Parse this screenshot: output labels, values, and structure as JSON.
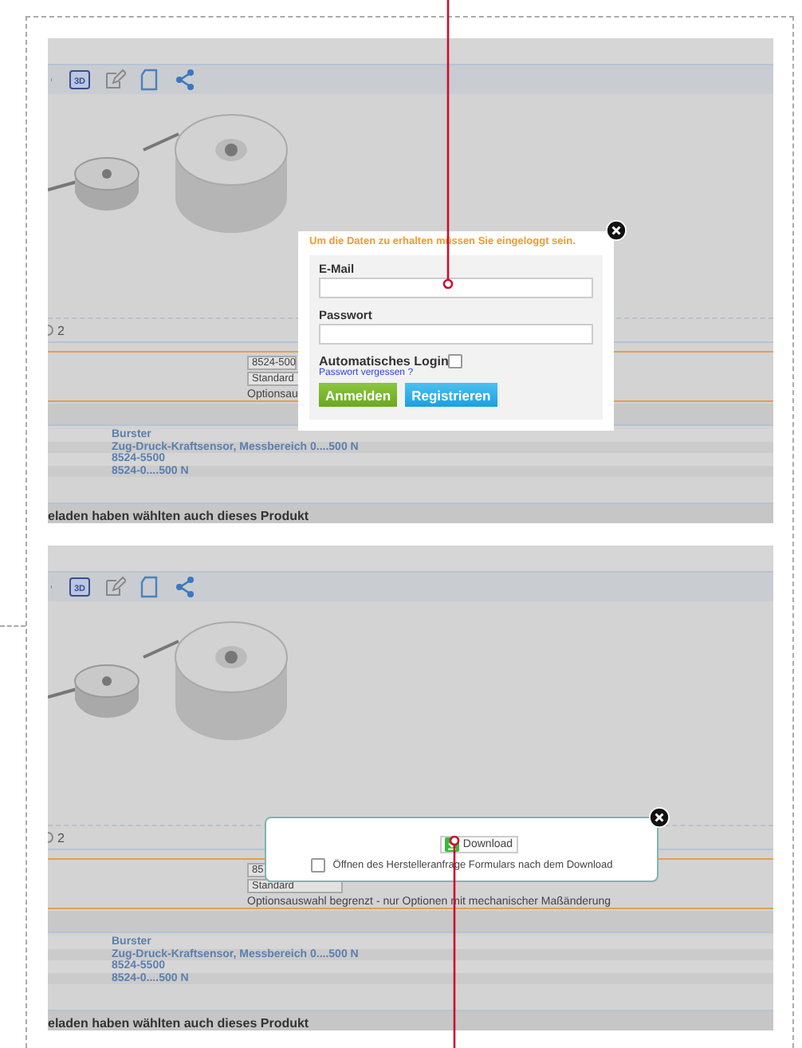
{
  "panels": [
    {
      "toolbar_label": "3D",
      "variant_count": "2",
      "selects": [
        "8524-500",
        "Standard"
      ],
      "option_note": "Optionsau",
      "details": [
        "Burster",
        "Zug-Druck-Kraftsensor, Messbereich 0....500 N",
        "8524-5500",
        "8524-0....500 N"
      ],
      "footer": "eladen haben wählten auch dieses Produkt",
      "dialog": {
        "kind": "login",
        "message": "Um die Daten zu erhalten müssen Sie eingeloggt sein.",
        "fields": [
          "E-Mail",
          "Passwort"
        ],
        "auto_login": {
          "label": "Automatisches Login",
          "checked": false
        },
        "forgot_link": "Passwort vergessen ?",
        "buttons": [
          {
            "label": "Anmelden",
            "kind": "primary"
          },
          {
            "label": "Registrieren",
            "kind": "secondary"
          }
        ]
      }
    },
    {
      "toolbar_label": "3D",
      "variant_count": "2",
      "selects": [
        "85",
        "Standard"
      ],
      "option_note": "Optionsauswahl begrenzt - nur Optionen mit mechanischer Maßänderung",
      "details": [
        "Burster",
        "Zug-Druck-Kraftsensor, Messbereich 0....500 N",
        "8524-5500",
        "8524-0....500 N"
      ],
      "footer": "eladen haben wählten auch dieses Produkt",
      "dialog": {
        "kind": "download",
        "button": "Download",
        "open_form": {
          "label": "Öffnen des Herstelleranfrage Formulars nach dem Download",
          "checked": false
        }
      }
    }
  ]
}
